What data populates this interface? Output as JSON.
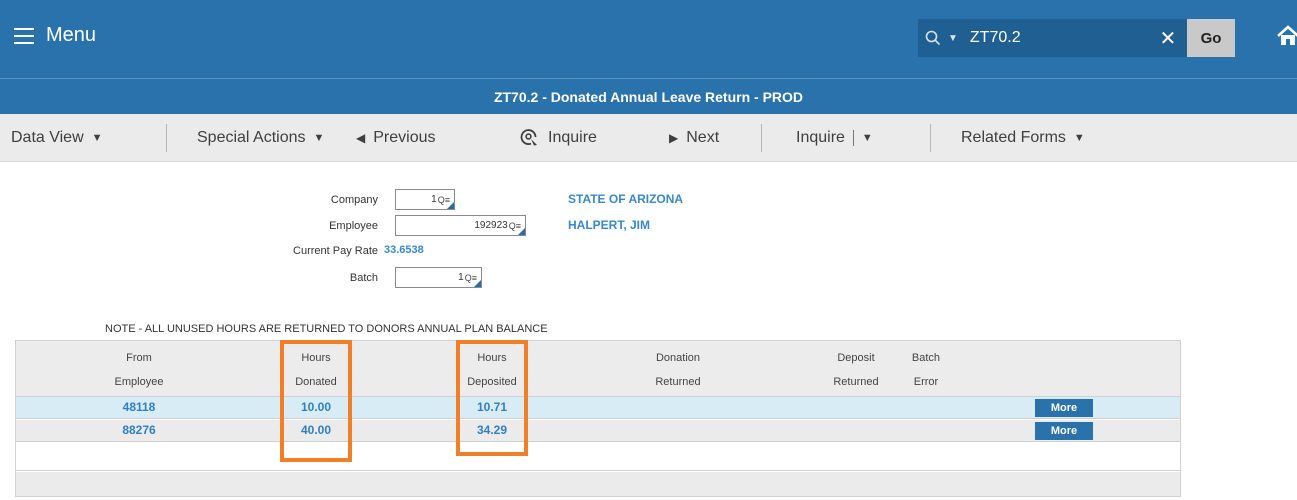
{
  "header": {
    "menu_label": "Menu",
    "search_value": "ZT70.2",
    "clear_glyph": "✕",
    "go_label": "Go",
    "icons": [
      "hamburger-icon",
      "search-icon",
      "chevron-down-icon",
      "close-icon",
      "home-icon"
    ]
  },
  "title": "ZT70.2 - Donated Annual Leave Return - PROD",
  "toolbar": {
    "data_view": "Data View",
    "special_actions": "Special Actions",
    "previous": "Previous",
    "inquire_icon_label": "Inquire",
    "next": "Next",
    "inquire_dropdown": "Inquire",
    "related_forms": "Related Forms"
  },
  "form": {
    "company_label": "Company",
    "company_value": "1",
    "company_name": "STATE OF ARIZONA",
    "employee_label": "Employee",
    "employee_value": "192923",
    "employee_name": "HALPERT, JIM",
    "pay_rate_label": "Current Pay Rate",
    "pay_rate_value": "33.6538",
    "batch_label": "Batch",
    "batch_value": "1"
  },
  "note": "NOTE - ALL UNUSED HOURS ARE RETURNED TO DONORS ANNUAL PLAN BALANCE",
  "grid": {
    "headers": [
      [
        "From",
        "Employee"
      ],
      [
        "Hours",
        "Donated"
      ],
      [
        "Hours",
        "Deposited"
      ],
      [
        "Donation",
        "Returned"
      ],
      [
        "Deposit",
        "Returned"
      ],
      [
        "Batch",
        "Error"
      ]
    ],
    "rows": [
      {
        "from_employee": "48118",
        "hours_donated": "10.00",
        "hours_deposited": "10.71",
        "more": "More"
      },
      {
        "from_employee": "88276",
        "hours_donated": "40.00",
        "hours_deposited": "34.29",
        "more": "More"
      }
    ]
  },
  "colors": {
    "brand": "#2a72ab",
    "link_value": "#3a87c8",
    "highlight": "#f07f27",
    "selected_row": "#d8ecf6"
  }
}
